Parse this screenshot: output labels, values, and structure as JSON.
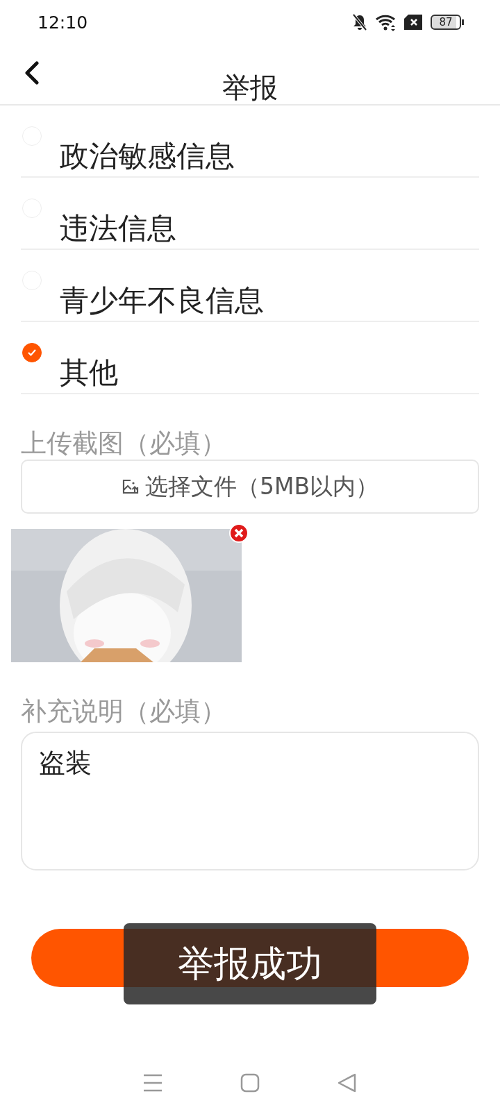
{
  "status_bar": {
    "time": "12:10",
    "battery": "87"
  },
  "header": {
    "title": "举报"
  },
  "options": [
    {
      "label": "政治敏感信息",
      "selected": false
    },
    {
      "label": "违法信息",
      "selected": false
    },
    {
      "label": "青少年不良信息",
      "selected": false
    },
    {
      "label": "其他",
      "selected": true
    }
  ],
  "upload": {
    "label": "上传截图（必填）",
    "button": "选择文件（5MB以内）"
  },
  "description": {
    "label": "补充说明（必填）",
    "value": "盗装"
  },
  "toast": {
    "text": "举报成功"
  }
}
